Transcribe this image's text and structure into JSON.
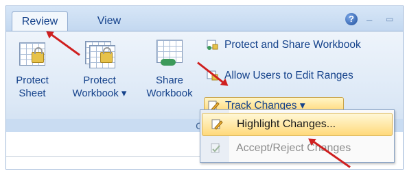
{
  "tabs": [
    {
      "label": "Review",
      "active": true
    },
    {
      "label": "View",
      "active": false
    }
  ],
  "window_controls": {
    "help": "?",
    "minimize": "–",
    "restore": "▭"
  },
  "big_buttons": [
    {
      "line1": "Protect",
      "line2": "Sheet"
    },
    {
      "line1": "Protect",
      "line2": "Workbook ▾"
    },
    {
      "line1": "Share",
      "line2": "Workbook"
    }
  ],
  "small_buttons": [
    {
      "label": "Protect and Share Workbook"
    },
    {
      "label": "Allow Users to Edit Ranges"
    },
    {
      "label": "Track Changes ▾"
    }
  ],
  "group_label": "Cha",
  "menu": {
    "items": [
      {
        "label": "Highlight Changes...",
        "enabled": true,
        "highlighted": true
      },
      {
        "label": "Accept/Reject Changes",
        "enabled": false,
        "highlighted": false
      }
    ]
  },
  "colors": {
    "annotation_arrow": "#cf1f1f",
    "tab_text": "#15428b"
  }
}
